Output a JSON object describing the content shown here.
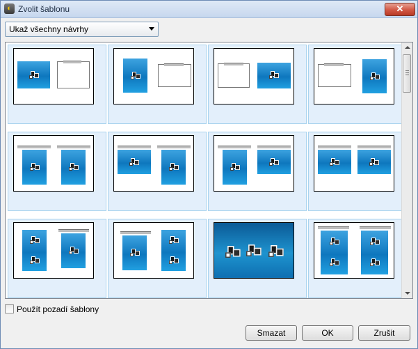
{
  "window": {
    "title": "Zvolit šablonu",
    "close_glyph": "✕",
    "app_icon": "app-logo-icon"
  },
  "design_filter": {
    "selected": "Ukaž všechny návrhy"
  },
  "template_gallery": {
    "selected_index": 0,
    "columns": 4,
    "visible_rows": 3,
    "colors": {
      "cell_background": "#e3effb",
      "cell_border": "#a9d3ee",
      "thumbnail_blue": "#1a8fd6"
    }
  },
  "options": {
    "use_template_background_label": "Použít pozadí šablony",
    "use_template_background_checked": false
  },
  "buttons": {
    "delete": "Smazat",
    "ok": "OK",
    "cancel": "Zrušit"
  }
}
